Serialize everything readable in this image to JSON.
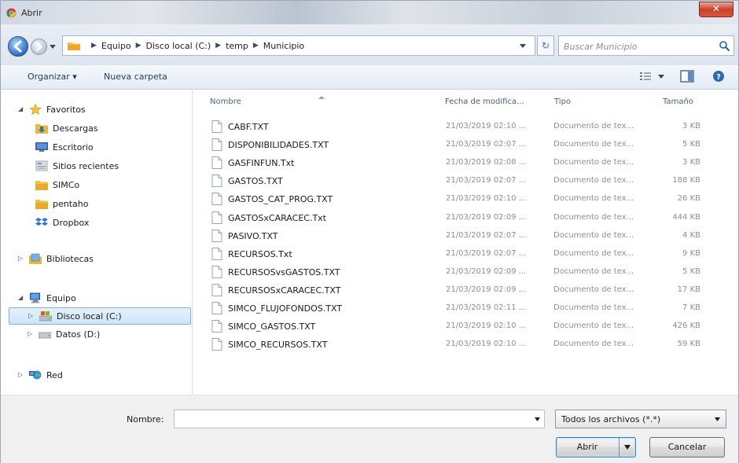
{
  "window": {
    "title": "Abrir",
    "close_glyph": "✕"
  },
  "address": {
    "crumbs": [
      "Equipo",
      "Disco local (C:)",
      "temp",
      "Municipio"
    ],
    "refresh_glyph": "↻",
    "search_placeholder": "Buscar Municipio"
  },
  "toolbar": {
    "organize": "Organizar ▾",
    "new_folder": "Nueva carpeta"
  },
  "nav": {
    "favorites": "Favoritos",
    "descargas": "Descargas",
    "escritorio": "Escritorio",
    "sitios": "Sitios recientes",
    "simco": "SIMCo",
    "pentaho": "pentaho",
    "dropbox": "Dropbox",
    "bibliotecas": "Bibliotecas",
    "equipo": "Equipo",
    "disco_c": "Disco local (C:)",
    "datos_d": "Datos (D:)",
    "red": "Red"
  },
  "columns": {
    "name": "Nombre",
    "date": "Fecha de modifica...",
    "type": "Tipo",
    "size": "Tamaño"
  },
  "files": [
    {
      "name": "CABF.TXT",
      "date": "21/03/2019 02:10 ...",
      "type": "Documento de tex...",
      "size": "3 KB"
    },
    {
      "name": "DISPONIBILIDADES.TXT",
      "date": "21/03/2019 02:07 ...",
      "type": "Documento de tex...",
      "size": "5 KB"
    },
    {
      "name": "GASFINFUN.Txt",
      "date": "21/03/2019 02:08 ...",
      "type": "Documento de tex...",
      "size": "3 KB"
    },
    {
      "name": "GASTOS.TXT",
      "date": "21/03/2019 02:07 ...",
      "type": "Documento de tex...",
      "size": "188 KB"
    },
    {
      "name": "GASTOS_CAT_PROG.TXT",
      "date": "21/03/2019 02:10 ...",
      "type": "Documento de tex...",
      "size": "26 KB"
    },
    {
      "name": "GASTOSxCARACEC.Txt",
      "date": "21/03/2019 02:09 ...",
      "type": "Documento de tex...",
      "size": "444 KB"
    },
    {
      "name": "PASIVO.TXT",
      "date": "21/03/2019 02:07 ...",
      "type": "Documento de tex...",
      "size": "4 KB"
    },
    {
      "name": "RECURSOS.Txt",
      "date": "21/03/2019 02:07 ...",
      "type": "Documento de tex...",
      "size": "9 KB"
    },
    {
      "name": "RECURSOSvsGASTOS.TXT",
      "date": "21/03/2019 02:09 ...",
      "type": "Documento de tex...",
      "size": "5 KB"
    },
    {
      "name": "RECURSOSxCARACEC.TXT",
      "date": "21/03/2019 02:09 ...",
      "type": "Documento de tex...",
      "size": "17 KB"
    },
    {
      "name": "SIMCO_FLUJOFONDOS.TXT",
      "date": "21/03/2019 02:11 ...",
      "type": "Documento de tex...",
      "size": "7 KB"
    },
    {
      "name": "SIMCO_GASTOS.TXT",
      "date": "21/03/2019 02:10 ...",
      "type": "Documento de tex...",
      "size": "426 KB"
    },
    {
      "name": "SIMCO_RECURSOS.TXT",
      "date": "21/03/2019 02:10 ...",
      "type": "Documento de tex...",
      "size": "59 KB"
    }
  ],
  "bottom": {
    "name_label": "Nombre:",
    "name_value": "",
    "filetype": "Todos los archivos (*.*)",
    "open": "Abrir",
    "cancel": "Cancelar"
  }
}
